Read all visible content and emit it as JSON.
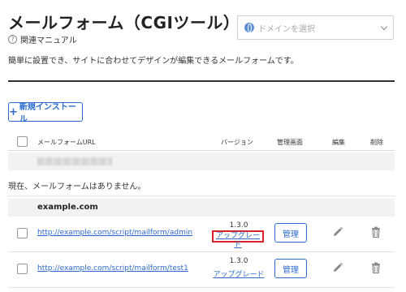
{
  "page": {
    "title": "メールフォーム（CGIツール）",
    "help_link": "関連マニュアル",
    "description": "簡単に設置でき、サイトに合わせてデザインが編集できるメールフォームです。",
    "accent_color": "#2d6bcf",
    "highlight_color": "#d8232a"
  },
  "domain_select": {
    "placeholder": "ドメインを選択",
    "icon": "globe-icon"
  },
  "toolbar": {
    "new_install_label": "新規インストール"
  },
  "table": {
    "headers": {
      "url": "メールフォームURL",
      "version": "バージョン",
      "admin": "管理画面",
      "edit": "編集",
      "delete": "削除"
    },
    "empty_message": "現在、メールフォームはありません。",
    "group_label": "example.com",
    "rows": [
      {
        "url": "http://example.com/script/mailform/admin",
        "version": "1.3.0",
        "upgrade": "アップグレード",
        "manage": "管理",
        "highlighted": true
      },
      {
        "url": "http://example.com/script/mailform/test1",
        "version": "1.3.0",
        "upgrade": "アップグレード",
        "manage": "管理",
        "highlighted": false
      }
    ]
  }
}
